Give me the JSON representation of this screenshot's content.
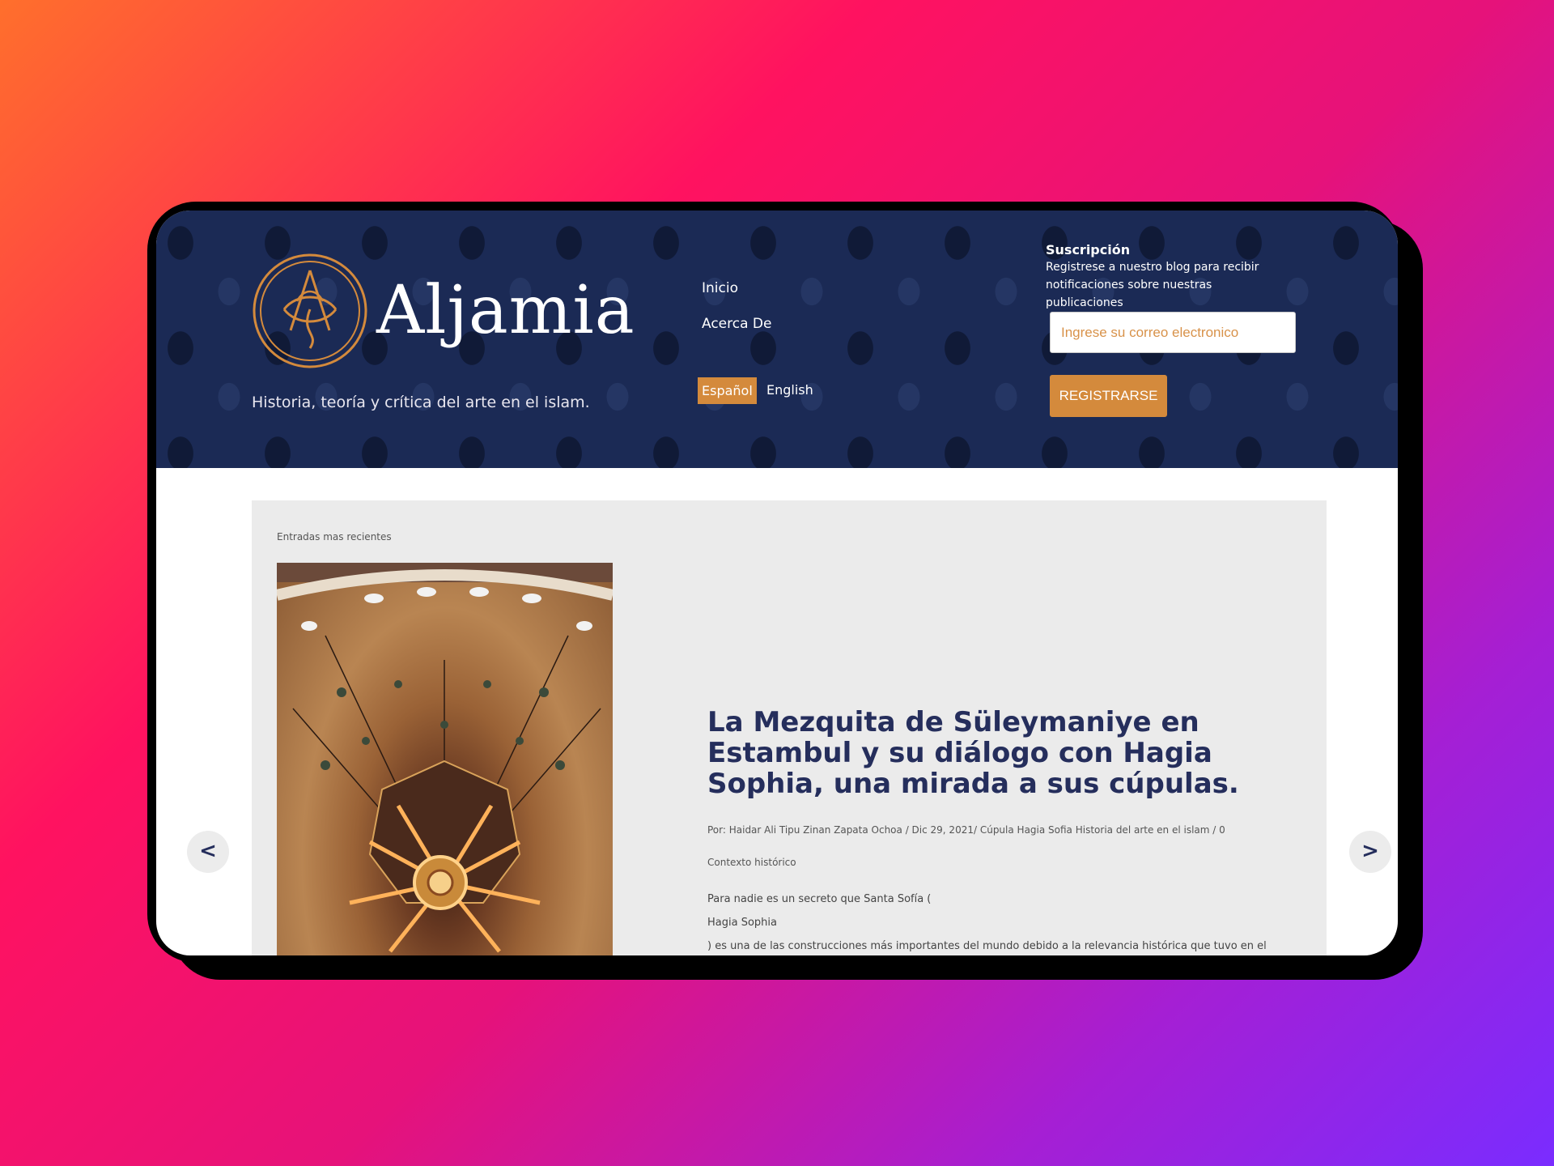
{
  "brand": {
    "name": "Aljamia",
    "tagline": "Historia, teoría y crítica del arte en el islam."
  },
  "nav": {
    "items": [
      {
        "label": "Inicio"
      },
      {
        "label": "Acerca De"
      }
    ]
  },
  "language": {
    "active": "Español",
    "other": "English"
  },
  "subscription": {
    "title": "Suscripción",
    "description": "Registrese a nuestro blog para recibir notificaciones sobre nuestras publicaciones",
    "email_placeholder": "Ingrese su correo electronico",
    "button_label": "REGISTRARSE"
  },
  "content": {
    "section_label": "Entradas mas recientes",
    "post": {
      "title": "La Mezquita de Süleymaniye en Estambul y su diálogo con Hagia Sophia, una mirada a sus cúpulas.",
      "meta": "Por: Haidar Ali Tipu Zinan Zapata Ochoa / Dic 29, 2021/ Cúpula Hagia Sofia Historia del arte en el islam / 0",
      "context": "Contexto histórico",
      "lines": [
        "  Para nadie es un secreto que Santa Sofía (",
        "Hagia Sophia",
        ") es una de las construcciones más importantes del mundo debido a la relevancia histórica que tuvo en el"
      ]
    },
    "prev_label": "<",
    "next_label": ">"
  },
  "colors": {
    "header_bg": "#1b2a55",
    "accent": "#d48a3c",
    "title": "#252e5c"
  },
  "icons": {
    "logo": "aljamia-calligraphy-logo-icon",
    "prev": "chevron-left-icon",
    "next": "chevron-right-icon"
  }
}
